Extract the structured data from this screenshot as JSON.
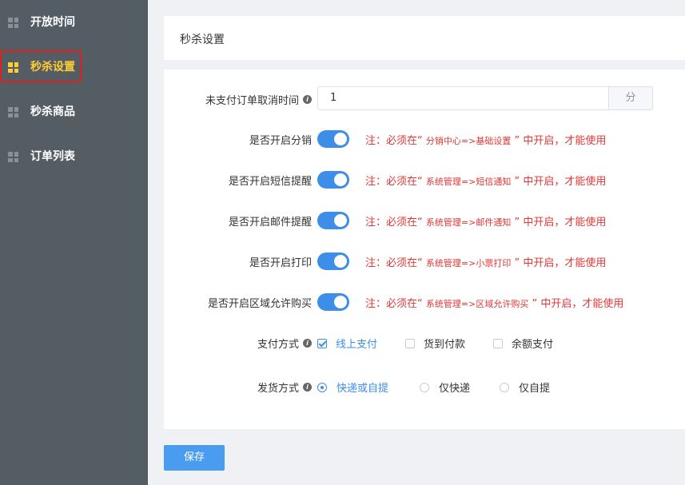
{
  "sidebar": {
    "items": [
      {
        "label": "开放时间",
        "active": false
      },
      {
        "label": "秒杀设置",
        "active": true
      },
      {
        "label": "秒杀商品",
        "active": false
      },
      {
        "label": "订单列表",
        "active": false
      }
    ]
  },
  "header": {
    "title": "秒杀设置"
  },
  "form": {
    "cancel_time": {
      "label": "未支付订单取消时间",
      "value": "1",
      "unit": "分"
    },
    "switches": [
      {
        "label": "是否开启分销",
        "enabled": true,
        "note_pre": "注：必须在",
        "note_quote_open": "“",
        "note_path": "分销中心=>基础设置",
        "note_quote_close": "”",
        "note_post": "中开启，才能使用"
      },
      {
        "label": "是否开启短信提醒",
        "enabled": true,
        "note_pre": "注：必须在",
        "note_quote_open": "“",
        "note_path": "系统管理=>短信通知",
        "note_quote_close": "”",
        "note_post": "中开启，才能使用"
      },
      {
        "label": "是否开启邮件提醒",
        "enabled": true,
        "note_pre": "注：必须在",
        "note_quote_open": "“",
        "note_path": "系统管理=>邮件通知",
        "note_quote_close": "”",
        "note_post": "中开启，才能使用"
      },
      {
        "label": "是否开启打印",
        "enabled": true,
        "note_pre": "注：必须在",
        "note_quote_open": "“",
        "note_path": "系统管理=>小票打印",
        "note_quote_close": "”",
        "note_post": "中开启，才能使用"
      },
      {
        "label": "是否开启区域允许购买",
        "enabled": true,
        "note_pre": "注：必须在",
        "note_quote_open": "“",
        "note_path": "系统管理=>区域允许购买",
        "note_quote_close": "”",
        "note_post": "中开启，才能使用"
      }
    ],
    "payment": {
      "label": "支付方式",
      "options": [
        {
          "label": "线上支付",
          "checked": true
        },
        {
          "label": "货到付款",
          "checked": false
        },
        {
          "label": "余额支付",
          "checked": false
        }
      ]
    },
    "delivery": {
      "label": "发货方式",
      "options": [
        {
          "label": "快递或自提",
          "selected": true
        },
        {
          "label": "仅快递",
          "selected": false
        },
        {
          "label": "仅自提",
          "selected": false
        }
      ]
    }
  },
  "save_label": "保存",
  "colors": {
    "accent": "#3c8ee8",
    "sidebar_bg": "#545c64",
    "active_nav": "#ffcc33",
    "note": "#e03636",
    "highlight_border": "#e02020"
  }
}
